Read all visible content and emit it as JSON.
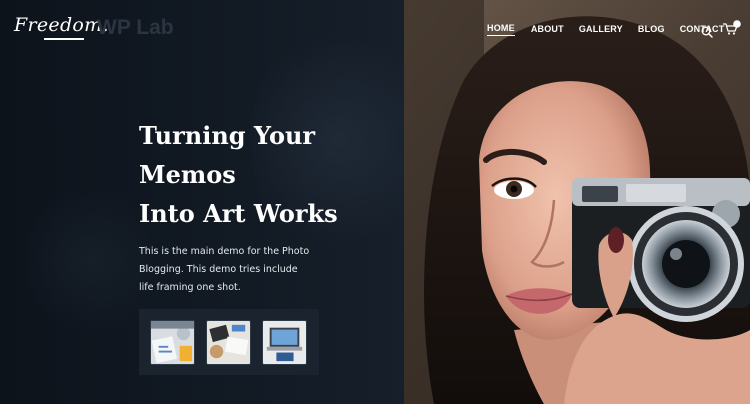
{
  "brand": {
    "logo": "Freedom.",
    "ghost_title": "WP Lab"
  },
  "nav": {
    "items": [
      {
        "label": "HOME",
        "active": true
      },
      {
        "label": "ABOUT",
        "active": false
      },
      {
        "label": "GALLERY",
        "active": false
      },
      {
        "label": "BLOG",
        "active": false
      },
      {
        "label": "CONTACT",
        "active": false
      }
    ],
    "search_icon": "search-icon",
    "cart_icon": "cart-icon",
    "cart_badge_color": "#ffffff"
  },
  "hero": {
    "title_lines": [
      "Turning Your",
      "Memos",
      "Into Art Works"
    ],
    "description": "This is the main demo for the Photo Blogging. This demo tries include life framing one shot.",
    "thumbnails": [
      "workspace-thumbnail",
      "desk-thumbnail",
      "laptop-thumbnail"
    ]
  },
  "colors": {
    "panel_bg": "#0f151d",
    "text": "#ffffff",
    "thumb_bar_bg": "#1a232e"
  }
}
